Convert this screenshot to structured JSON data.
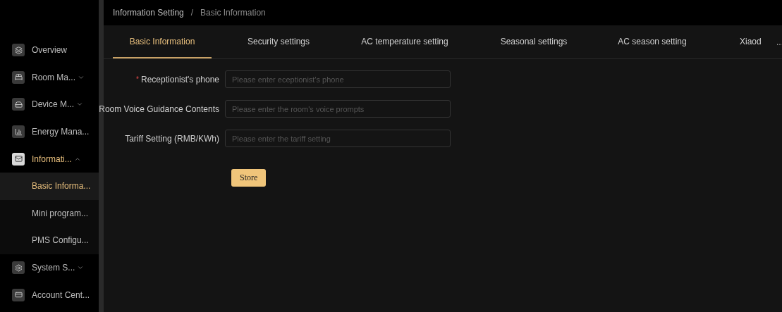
{
  "sidebar": {
    "items": [
      {
        "label": "Overview",
        "kind": "link",
        "selected": false
      },
      {
        "label": "Room Ma...",
        "kind": "group",
        "selected": false,
        "expanded": false
      },
      {
        "label": "Device M...",
        "kind": "group",
        "selected": false,
        "expanded": false
      },
      {
        "label": "Energy Mana...",
        "kind": "link",
        "selected": false
      },
      {
        "label": "Informati...",
        "kind": "group",
        "selected": true,
        "expanded": true,
        "children": [
          {
            "label": "Basic Informa...",
            "selected": true
          },
          {
            "label": "Mini program...",
            "selected": false
          },
          {
            "label": "PMS Configu...",
            "selected": false
          }
        ]
      },
      {
        "label": "System S...",
        "kind": "group",
        "selected": false,
        "expanded": false
      },
      {
        "label": "Account Cent...",
        "kind": "link",
        "selected": false
      }
    ]
  },
  "breadcrumb": [
    "Information Setting",
    "/",
    "Basic Information"
  ],
  "tabs": [
    {
      "label": "Basic Information",
      "selected": true
    },
    {
      "label": "Security settings",
      "selected": false
    },
    {
      "label": "AC temperature setting",
      "selected": false
    },
    {
      "label": "Seasonal settings",
      "selected": false
    },
    {
      "label": "AC season setting",
      "selected": false
    },
    {
      "label": "Xiaod",
      "selected": false
    }
  ],
  "tabs_more": "...",
  "form": {
    "fields": [
      {
        "label": "Receptionist's phone",
        "required_mark": "*",
        "placeholder": "Please enter eceptionist's phone"
      },
      {
        "label": "Room Voice Guidance Contents",
        "placeholder": "Please enter the room's voice prompts"
      },
      {
        "label": "Tariff Setting (RMB/KWh)",
        "placeholder": "Please enter the tariff setting"
      }
    ],
    "submit": "Store"
  }
}
